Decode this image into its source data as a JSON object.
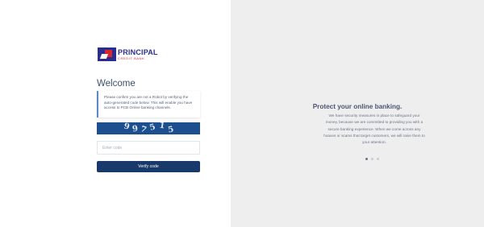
{
  "brand": {
    "name": "PRINCIPAL",
    "subtitle": "CREDIT BANK"
  },
  "form": {
    "heading": "Welcome",
    "notice": "Please confirm you are not a Robot by verifying the auto-generated code below. This will enable you have access to PCB Online banking channels.",
    "captcha_chars": [
      "9",
      "9",
      "7",
      "5",
      "1",
      "5"
    ],
    "code_input": {
      "value": "",
      "placeholder": "Enter code"
    },
    "verify_label": "Verify code"
  },
  "promo": {
    "title": "Protect your online banking.",
    "text": "We have security measures in place to safeguard your money, because we are committed to providing you with a secure banking experience. When we come across any hoaxes or scams that target customers, we will raise them to your attention.",
    "slides_total": 3,
    "active_slide": 1
  },
  "colors": {
    "brand_blue": "#2b2c8f",
    "brand_red": "#d9262c",
    "button": "#183a6b",
    "captcha_bg": "#1d4e8e",
    "panel_bg": "#eeeeef"
  }
}
